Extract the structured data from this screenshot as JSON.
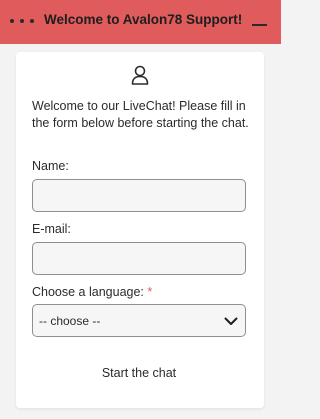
{
  "header": {
    "title": "Welcome to Avalon78 Support!",
    "menu_icon": "more-dots-icon",
    "minimize_icon": "minimize-icon",
    "background_color": "#e05b5b"
  },
  "form": {
    "avatar_icon": "user-icon",
    "intro_text": "Welcome to our LiveChat! Please fill in the form below before starting the chat.",
    "name": {
      "label": "Name:",
      "value": "",
      "placeholder": ""
    },
    "email": {
      "label": "E-mail:",
      "value": "",
      "placeholder": ""
    },
    "language": {
      "label": "Choose a language:",
      "required_mark": "*",
      "selected": "-- choose --",
      "icon": "chevron-down-icon"
    },
    "start_button": "Start the chat"
  },
  "colors": {
    "accent": "#e05b5b",
    "text": "#2b2b2b",
    "input_bg": "#f6f6f6",
    "input_border": "#8f8f8f"
  }
}
